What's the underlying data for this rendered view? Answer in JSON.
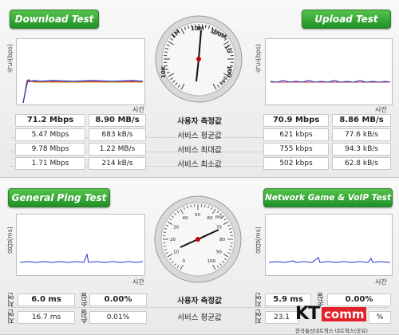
{
  "colors": {
    "header_green": "#2e9a33",
    "line_blue": "#2233cc",
    "line_red": "#e0342a",
    "line_orange": "#e8a020",
    "needle": "#111111",
    "logo_red": "#e2232a"
  },
  "download": {
    "title": "Download Test",
    "ylabel": "속도(bps)",
    "time": "시간",
    "values": [
      {
        "left": "71.2 Mbps",
        "right": "8.90 MB/s"
      },
      {
        "left": "5.47 Mbps",
        "right": "683 kB/s"
      },
      {
        "left": "9.78 Mbps",
        "right": "1.22 MB/s"
      },
      {
        "left": "1.71 Mbps",
        "right": "214 kB/s"
      }
    ]
  },
  "upload": {
    "title": "Upload Test",
    "ylabel": "속도(bps)",
    "time": "시간",
    "values": [
      {
        "left": "70.9 Mbps",
        "right": "8.86 MB/s"
      },
      {
        "left": "621 kbps",
        "right": "77.6 kB/s"
      },
      {
        "left": "755 kbps",
        "right": "94.3 kB/s"
      },
      {
        "left": "502 kbps",
        "right": "62.8 kB/s"
      }
    ]
  },
  "speed_labels": [
    "사용자 측정값",
    "서비스 평균값",
    "서비스 최대값",
    "서비스 최소값"
  ],
  "speed_gauge": {
    "scale_labels": [
      "1M",
      "10M",
      "100M",
      "1G",
      "10K",
      "10G"
    ],
    "unit": "bps"
  },
  "ping": {
    "title": "General Ping Test",
    "ylabel": "응답(ms)",
    "time": "시간",
    "row_labels": [
      "지연",
      "지연"
    ],
    "loss_labels": [
      "손실",
      "손실"
    ],
    "values": [
      {
        "delay": "6.0 ms",
        "loss": "0.00%"
      },
      {
        "delay": "16.7 ms",
        "loss": "0.01%"
      }
    ]
  },
  "game": {
    "title": "Network Game & VoIP Test",
    "ylabel": "응답(ms)",
    "time": "시간",
    "row_labels": [
      "지연",
      "지연"
    ],
    "loss_labels": [
      "손실",
      "손실"
    ],
    "values": [
      {
        "delay": "5.9 ms",
        "loss": "0.00%"
      },
      {
        "delay": "23.1",
        "loss": "%"
      }
    ]
  },
  "ping_labels": [
    "사용자 측정값",
    "서비스 평균값"
  ],
  "ping_gauge": {
    "scale_labels": [
      "0",
      "10",
      "20",
      "30",
      "40",
      "50",
      "60",
      "70",
      "80",
      "90",
      "100"
    ],
    "unit": "ms"
  },
  "logo": {
    "kt": "KT",
    "comm": "comm",
    "sub": "한국통신네트웍스·네트웍스(공유)"
  }
}
